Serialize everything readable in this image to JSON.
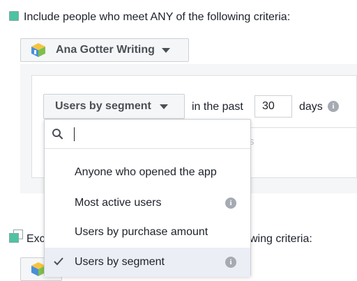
{
  "include": {
    "header_text": "Include people who meet ANY of the following criteria:"
  },
  "app_selector": {
    "app_name": "Ana Gotter Writing"
  },
  "rule": {
    "segment_button_label": "Users by segment",
    "in_the_past_label": "in the past",
    "days_value": "30",
    "days_label": "days"
  },
  "dropdown": {
    "search_value": "",
    "items": [
      {
        "label": "Anyone who opened the app",
        "selected": false,
        "has_info": false
      },
      {
        "label": "Most active users",
        "selected": false,
        "has_info": true
      },
      {
        "label": "Users by purchase amount",
        "selected": false,
        "has_info": false
      },
      {
        "label": "Users by segment",
        "selected": true,
        "has_info": true
      }
    ]
  },
  "exclude": {
    "header_left": "Exc",
    "header_right": "wing criteria:"
  },
  "background_hint": "s",
  "colors": {
    "include_square": "#4dc3a3",
    "selected_row": "#ebeef5",
    "panel_bg": "#f5f6f7",
    "icon_gray": "#a5aab3"
  }
}
